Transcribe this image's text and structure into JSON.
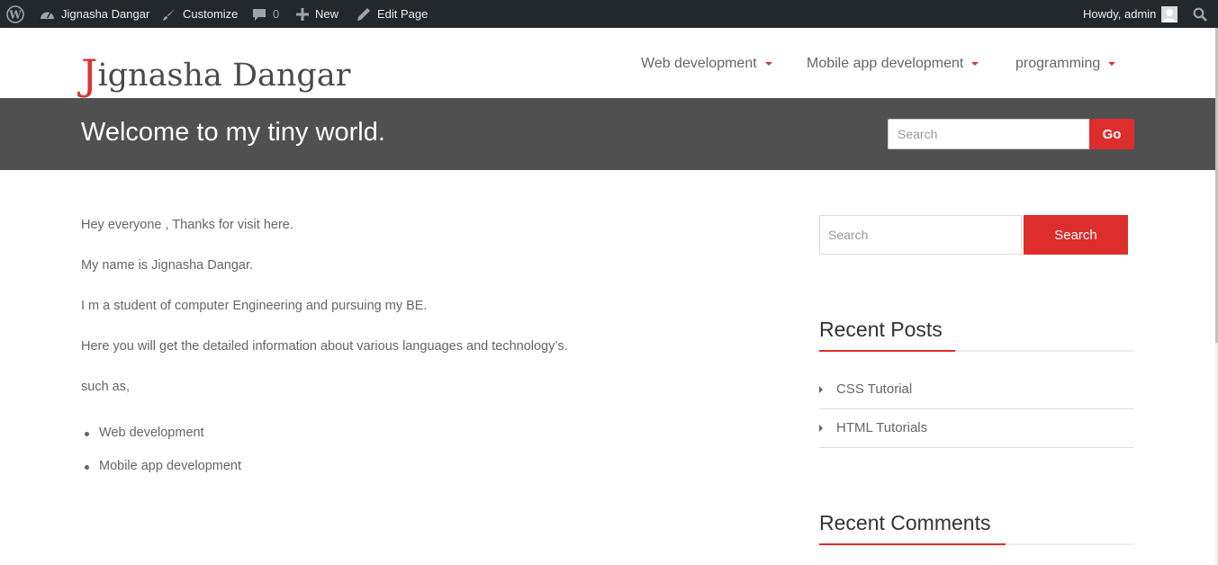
{
  "adminbar": {
    "site_name": "Jignasha Dangar",
    "customize": "Customize",
    "comments_count": "0",
    "new": "New",
    "edit_page": "Edit Page",
    "howdy": "Howdy, admin"
  },
  "header": {
    "logo_first": "J",
    "logo_rest": "ignasha Dangar",
    "nav": [
      "Web development",
      "Mobile app development",
      "programming"
    ]
  },
  "banner": {
    "title": "Welcome to my tiny world.",
    "search_placeholder": "Search",
    "go_label": "Go"
  },
  "content": {
    "paragraphs": [
      "Hey everyone , Thanks for visit here.",
      "My name is Jignasha Dangar.",
      "I m a student of computer Engineering and pursuing my BE.",
      "Here you will get the detailed information about various languages and technology’s.",
      "such as,"
    ],
    "list": [
      "Web development",
      "Mobile app development"
    ]
  },
  "sidebar": {
    "search_placeholder": "Search",
    "search_button": "Search",
    "recent_posts_title": "Recent Posts",
    "recent_posts": [
      "CSS Tutorial",
      "HTML Tutorials"
    ],
    "recent_comments_title": "Recent Comments"
  },
  "colors": {
    "accent": "#dd2d2d",
    "adminbar_bg": "#23282d",
    "banner_bg": "#505050"
  }
}
